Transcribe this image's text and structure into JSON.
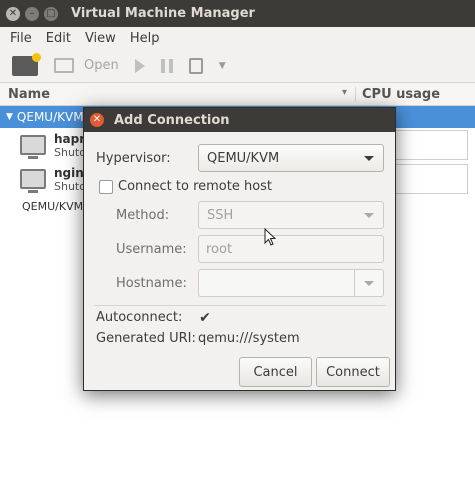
{
  "window": {
    "title": "Virtual Machine Manager"
  },
  "menu": {
    "items": [
      "File",
      "Edit",
      "View",
      "Help"
    ]
  },
  "toolbar": {
    "open_label": "Open"
  },
  "list": {
    "col_name": "Name",
    "col_cpu": "CPU usage",
    "connection": "QEMU/KVM",
    "vms": [
      {
        "name": "hapro",
        "status": "Shutoff"
      },
      {
        "name": "nginx",
        "status": "Shutoff"
      }
    ],
    "connection2": "QEMU/KVM"
  },
  "dialog": {
    "title": "Add Connection",
    "hypervisor_label": "Hypervisor:",
    "hypervisor_value": "QEMU/KVM",
    "remote_label": "Connect to remote host",
    "remote_checked": false,
    "method_label": "Method:",
    "method_value": "SSH",
    "username_label": "Username:",
    "username_value": "root",
    "hostname_label": "Hostname:",
    "hostname_value": "",
    "autoconnect_label": "Autoconnect:",
    "autoconnect_checked": true,
    "uri_label": "Generated URI:",
    "uri_value": "qemu:///system",
    "cancel_label": "Cancel",
    "connect_label": "Connect"
  }
}
